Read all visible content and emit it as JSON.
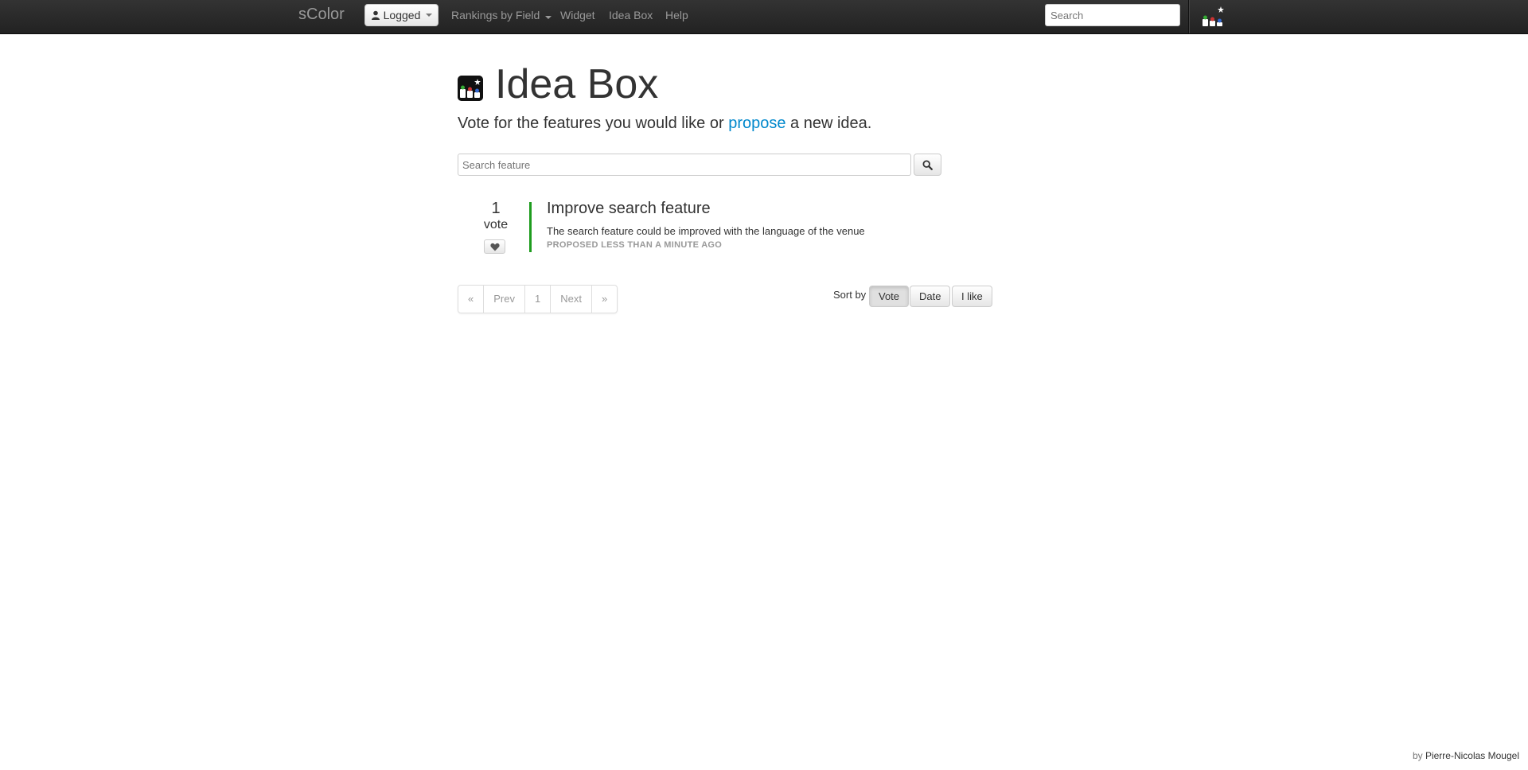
{
  "navbar": {
    "brand": "sColor",
    "logged_label": "Logged",
    "items": [
      {
        "label": "Rankings by Field"
      },
      {
        "label": "Widget"
      },
      {
        "label": "Idea Box"
      },
      {
        "label": "Help"
      }
    ],
    "search_placeholder": "Search"
  },
  "page": {
    "title": "Idea Box",
    "lead_before": "Vote for the features you would like or ",
    "lead_link": "propose",
    "lead_after": " a new idea.",
    "search_placeholder": "Search feature"
  },
  "ideas": [
    {
      "votes": "1",
      "vote_label": "vote",
      "title": "Improve search feature",
      "description": "The search feature could be improved with the language of the venue",
      "meta": "PROPOSED LESS THAN A MINUTE AGO"
    }
  ],
  "pagination": [
    "«",
    "Prev",
    "1",
    "Next",
    "»"
  ],
  "sort": {
    "label": "Sort by",
    "options": [
      "Vote",
      "Date",
      "I like"
    ],
    "active": "Vote"
  },
  "footer": {
    "prefix": "by ",
    "author": "Pierre-Nicolas Mougel"
  },
  "colors": {
    "navbar": "#222222",
    "link": "#0088cc",
    "idea_bar": "#1e9c1e"
  }
}
